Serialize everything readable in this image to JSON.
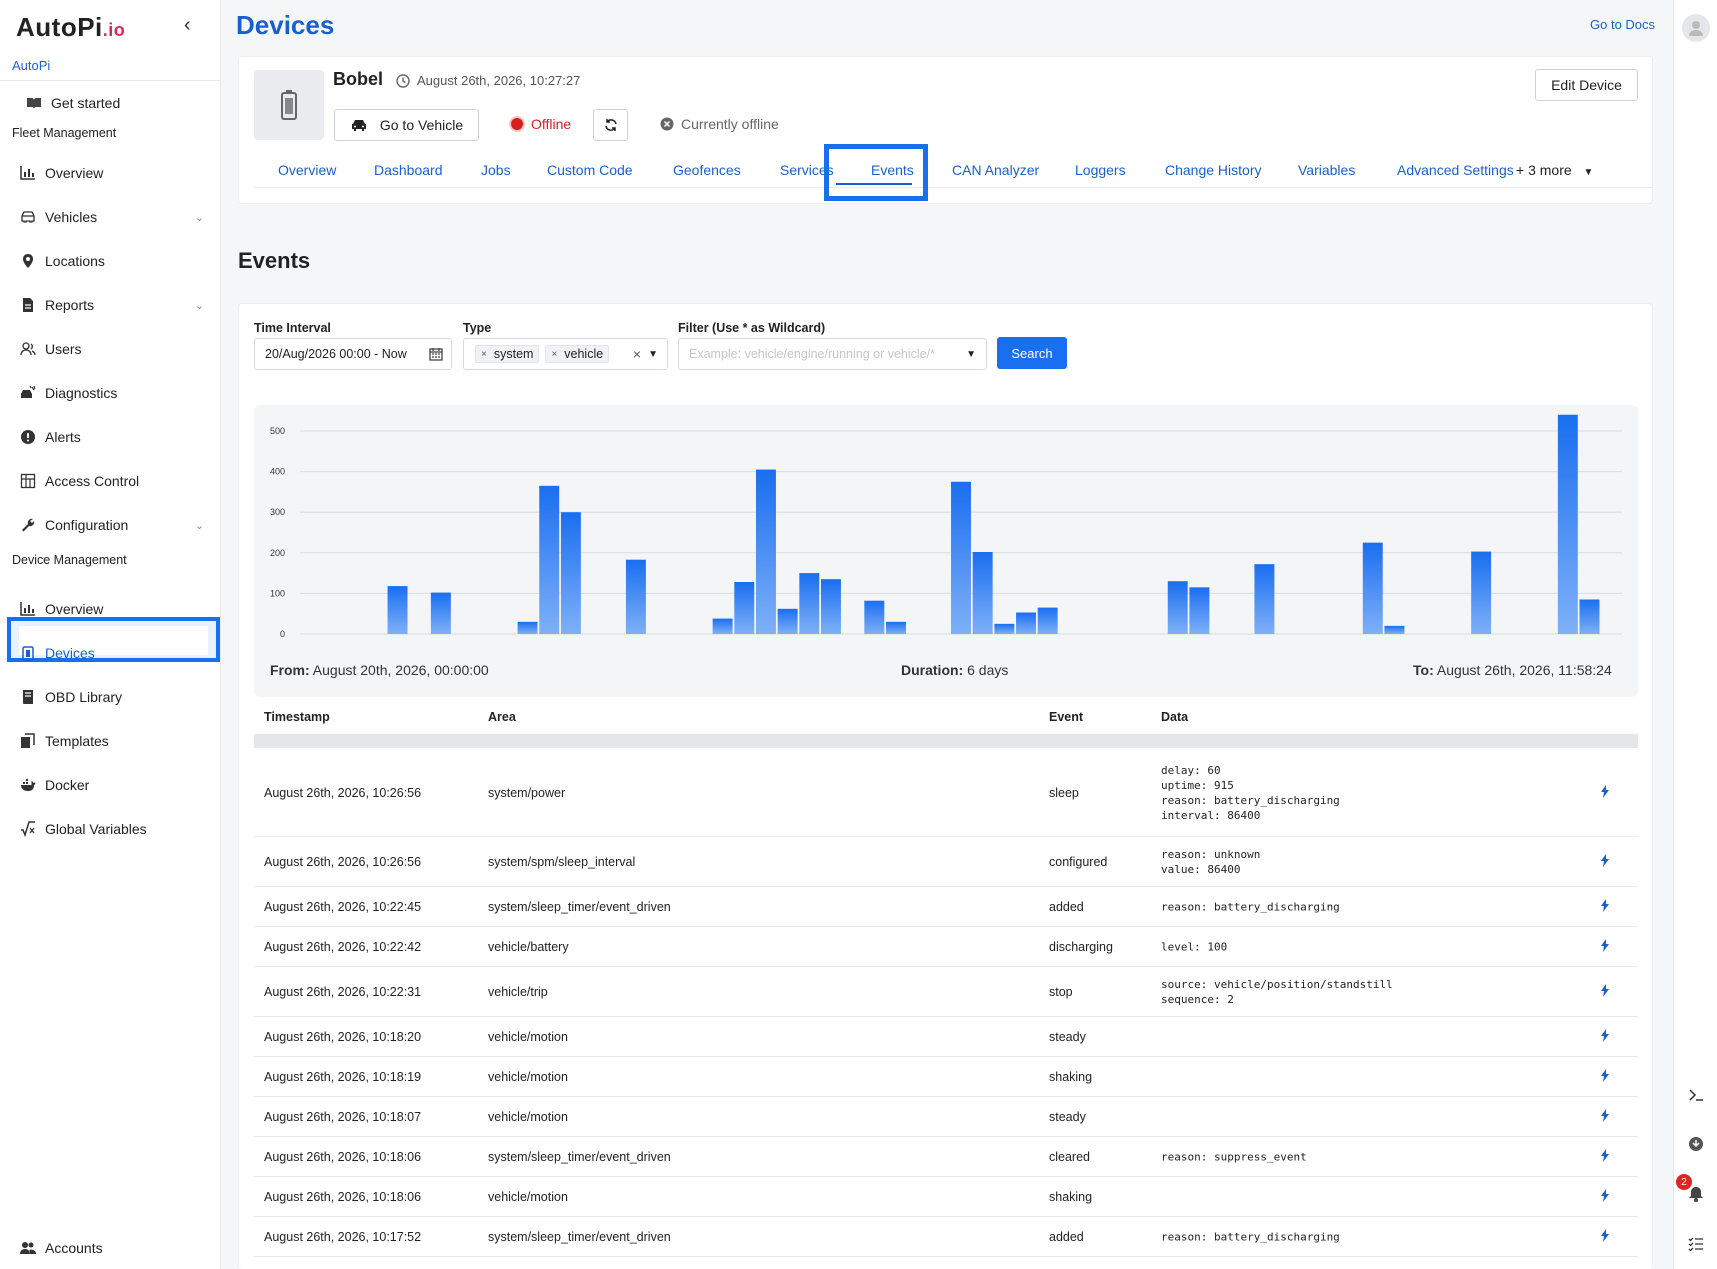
{
  "brand": {
    "logo_main": "AutoPi",
    "logo_suffix": ".io",
    "org": "AutoPi"
  },
  "sidebar": {
    "get_started": "Get started",
    "fleet_section": "Fleet Management",
    "fleet_items": [
      {
        "label": "Overview",
        "icon": "chart-icon"
      },
      {
        "label": "Vehicles",
        "icon": "car-icon",
        "expandable": true
      },
      {
        "label": "Locations",
        "icon": "pin-icon"
      },
      {
        "label": "Reports",
        "icon": "document-icon",
        "expandable": true
      },
      {
        "label": "Users",
        "icon": "users-icon"
      },
      {
        "label": "Diagnostics",
        "icon": "car-crash-icon"
      },
      {
        "label": "Alerts",
        "icon": "alert-icon"
      },
      {
        "label": "Access Control",
        "icon": "grid-icon"
      },
      {
        "label": "Configuration",
        "icon": "wrench-icon",
        "expandable": true
      }
    ],
    "device_section": "Device Management",
    "device_items": [
      {
        "label": "Overview",
        "icon": "chart-icon"
      },
      {
        "label": "Devices",
        "icon": "device-icon",
        "active": true
      },
      {
        "label": "OBD Library",
        "icon": "book-icon"
      },
      {
        "label": "Templates",
        "icon": "copy-icon"
      },
      {
        "label": "Docker",
        "icon": "docker-icon"
      },
      {
        "label": "Global Variables",
        "icon": "variable-icon"
      }
    ],
    "accounts": "Accounts"
  },
  "header": {
    "title": "Devices",
    "docs_link": "Go to Docs"
  },
  "device": {
    "name": "Bobel",
    "timestamp": "August 26th, 2026, 10:27:27",
    "go_to_vehicle": "Go to Vehicle",
    "status": "Offline",
    "status_detail": "Currently offline",
    "edit": "Edit Device"
  },
  "tabs": [
    "Overview",
    "Dashboard",
    "Jobs",
    "Custom Code",
    "Geofences",
    "Services",
    "Events",
    "CAN Analyzer",
    "Loggers",
    "Change History",
    "Variables",
    "Advanced Settings"
  ],
  "tabs_more": "+ 3 more",
  "active_tab": "Events",
  "events": {
    "title": "Events",
    "time_interval_label": "Time Interval",
    "time_interval_value": "20/Aug/2026 00:00 - Now",
    "type_label": "Type",
    "type_chips": [
      "system",
      "vehicle"
    ],
    "filter_label": "Filter (Use * as Wildcard)",
    "filter_placeholder": "Example: vehicle/engine/running or vehicle/*",
    "search": "Search",
    "from_label": "From:",
    "from_value": "August 20th, 2026, 00:00:00",
    "duration_label": "Duration:",
    "duration_value": "6 days",
    "to_label": "To:",
    "to_value": "August 26th, 2026, 11:58:24"
  },
  "chart_data": {
    "type": "bar",
    "ylim": [
      0,
      500
    ],
    "yticks": [
      0,
      100,
      200,
      300,
      400,
      500
    ],
    "color": "#1a6ef0",
    "values": [
      0,
      0,
      0,
      0,
      118,
      0,
      102,
      0,
      0,
      0,
      30,
      365,
      300,
      0,
      0,
      183,
      0,
      0,
      0,
      38,
      128,
      405,
      62,
      150,
      135,
      0,
      82,
      30,
      0,
      0,
      375,
      202,
      25,
      53,
      65,
      0,
      0,
      0,
      0,
      0,
      130,
      115,
      0,
      0,
      172,
      0,
      0,
      0,
      0,
      225,
      20,
      0,
      0,
      0,
      203,
      0,
      0,
      0,
      540,
      85,
      0
    ]
  },
  "table": {
    "headers": {
      "timestamp": "Timestamp",
      "area": "Area",
      "event": "Event",
      "data": "Data"
    },
    "rows": [
      {
        "ts": "August 26th, 2026, 10:26:56",
        "area": "system/power",
        "event": "sleep",
        "data": "delay: 60\nuptime: 915\nreason: battery_discharging\ninterval: 86400"
      },
      {
        "ts": "August 26th, 2026, 10:26:56",
        "area": "system/spm/sleep_interval",
        "event": "configured",
        "data": "reason: unknown\nvalue: 86400"
      },
      {
        "ts": "August 26th, 2026, 10:22:45",
        "area": "system/sleep_timer/event_driven",
        "event": "added",
        "data": "reason: battery_discharging"
      },
      {
        "ts": "August 26th, 2026, 10:22:42",
        "area": "vehicle/battery",
        "event": "discharging",
        "data": "level: 100"
      },
      {
        "ts": "August 26th, 2026, 10:22:31",
        "area": "vehicle/trip",
        "event": "stop",
        "data": "source: vehicle/position/standstill\nsequence: 2"
      },
      {
        "ts": "August 26th, 2026, 10:18:20",
        "area": "vehicle/motion",
        "event": "steady",
        "data": ""
      },
      {
        "ts": "August 26th, 2026, 10:18:19",
        "area": "vehicle/motion",
        "event": "shaking",
        "data": ""
      },
      {
        "ts": "August 26th, 2026, 10:18:07",
        "area": "vehicle/motion",
        "event": "steady",
        "data": ""
      },
      {
        "ts": "August 26th, 2026, 10:18:06",
        "area": "system/sleep_timer/event_driven",
        "event": "cleared",
        "data": "reason: suppress_event"
      },
      {
        "ts": "August 26th, 2026, 10:18:06",
        "area": "vehicle/motion",
        "event": "shaking",
        "data": ""
      },
      {
        "ts": "August 26th, 2026, 10:17:52",
        "area": "system/sleep_timer/event_driven",
        "event": "added",
        "data": "reason: battery_discharging"
      }
    ]
  },
  "notifications_count": "2"
}
